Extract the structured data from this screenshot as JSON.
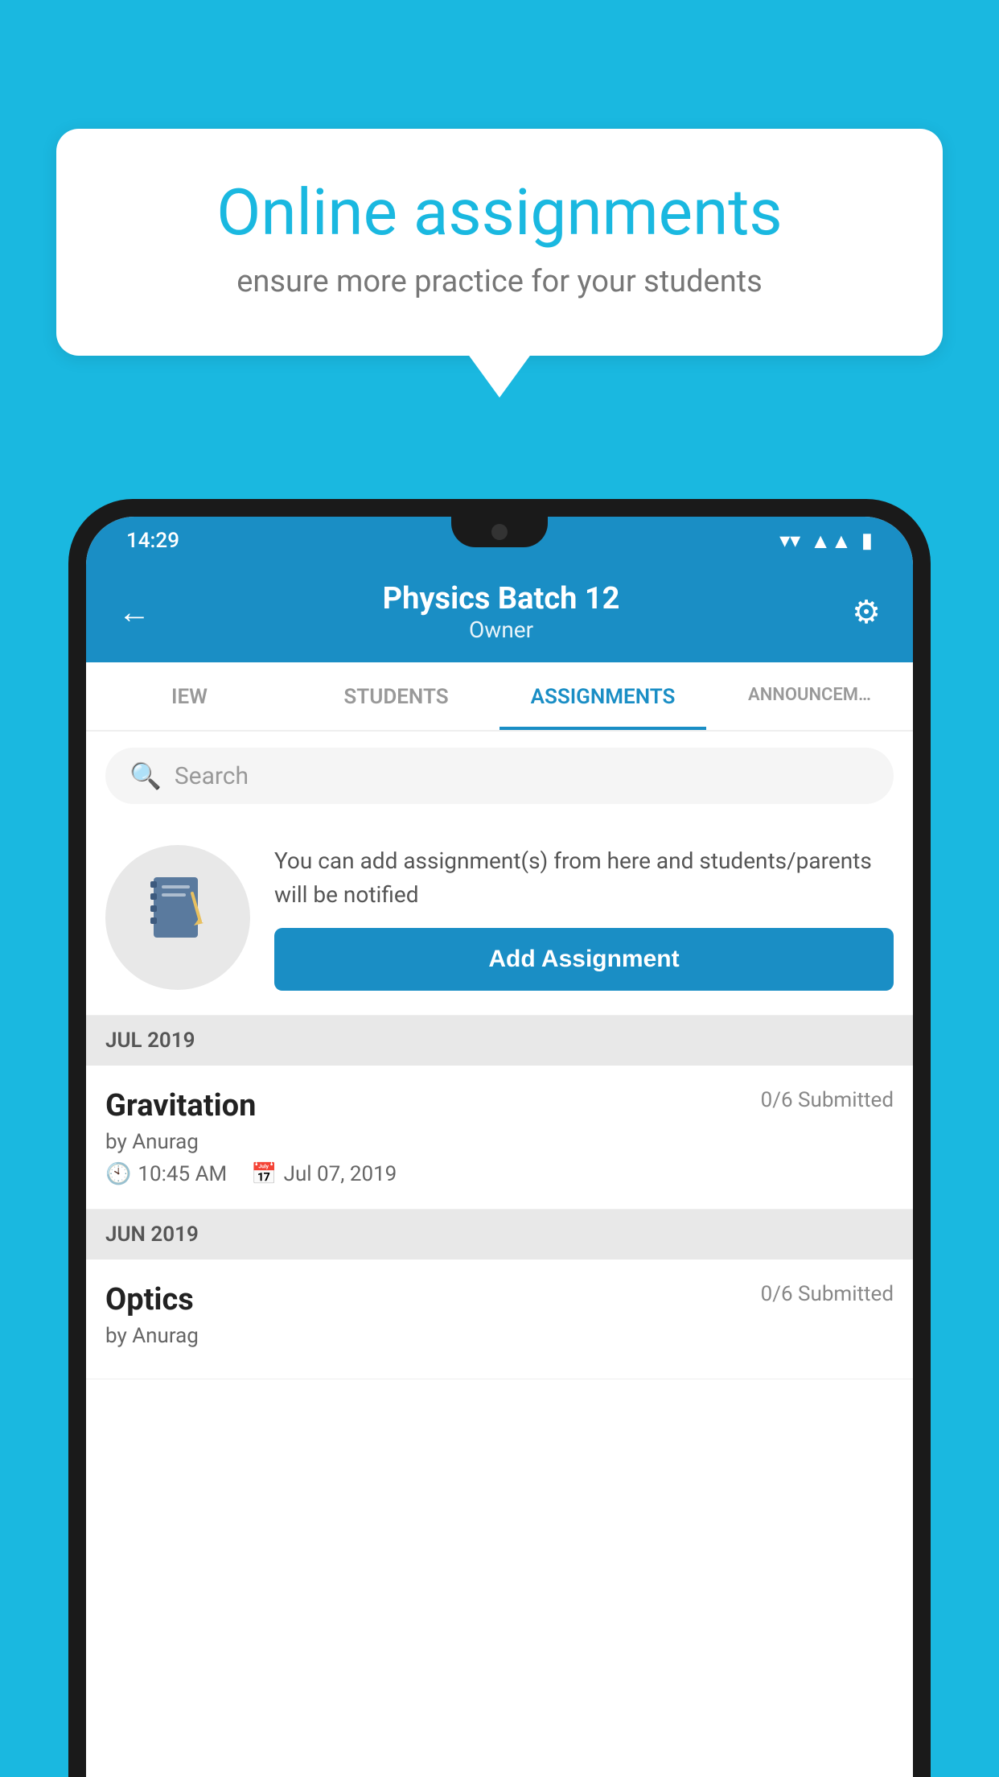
{
  "background": {
    "color": "#1ab8e0"
  },
  "speech_bubble": {
    "title": "Online assignments",
    "subtitle": "ensure more practice for your students"
  },
  "phone": {
    "status_bar": {
      "time": "14:29",
      "wifi_icon": "wifi",
      "signal_icon": "signal",
      "battery_icon": "battery"
    },
    "header": {
      "title": "Physics Batch 12",
      "subtitle": "Owner",
      "back_label": "←",
      "settings_label": "⚙"
    },
    "tabs": [
      {
        "label": "IEW",
        "active": false
      },
      {
        "label": "STUDENTS",
        "active": false
      },
      {
        "label": "ASSIGNMENTS",
        "active": true
      },
      {
        "label": "ANNOUNCEM…",
        "active": false
      }
    ],
    "search": {
      "placeholder": "Search"
    },
    "promo": {
      "icon": "📓",
      "text": "You can add assignment(s) from here and students/parents will be notified",
      "button_label": "Add Assignment"
    },
    "sections": [
      {
        "header": "JUL 2019",
        "assignments": [
          {
            "name": "Gravitation",
            "submitted": "0/6 Submitted",
            "by": "by Anurag",
            "time": "10:45 AM",
            "date": "Jul 07, 2019"
          }
        ]
      },
      {
        "header": "JUN 2019",
        "assignments": [
          {
            "name": "Optics",
            "submitted": "0/6 Submitted",
            "by": "by Anurag",
            "time": "",
            "date": ""
          }
        ]
      }
    ]
  }
}
